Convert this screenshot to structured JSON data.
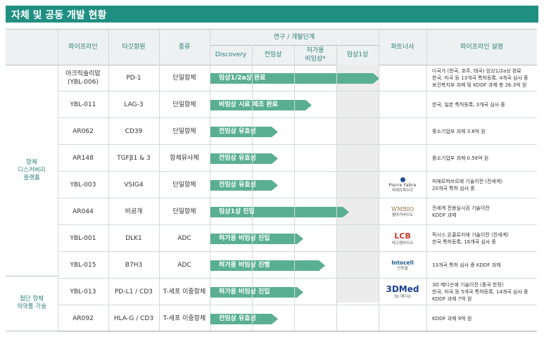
{
  "title": "자체 및 공동 개발 현황",
  "headers": {
    "pipeline": "파이프라인",
    "target": "타깃항원",
    "type": "종류",
    "stage_group": "연구 / 개발단계",
    "stages": [
      "Discovery",
      "전임상",
      "허가용\n비임상*",
      "임상1상"
    ],
    "partner": "파트너사",
    "description": "파이프라인 설명"
  },
  "platforms": [
    {
      "label": "항체\n디스커버리\n플랫폼"
    },
    {
      "label": "첨단 항체\n의약품 기술"
    }
  ],
  "rows": [
    {
      "pipeline": "아크릭솔리맙\n(YBL-006)",
      "target": "PD-1",
      "type": "단일항체",
      "stage_label": "임상1/2a상 완료",
      "progress": 1.0,
      "partner": "",
      "partner_sub": "",
      "description": [
        "다국가 (한국, 호주, 태국) 임상1/2a상 완료",
        "한국, 미국 등 13개국 특허등록, 4개국 심사 중",
        "보건복지부 과제 및 KDDF 과제 총 26.3억 원"
      ]
    },
    {
      "pipeline": "YBL-011",
      "target": "LAG-3",
      "type": "단일항체",
      "stage_label": "비임상 시료 제조 완료",
      "progress": 0.6,
      "partner": "",
      "partner_sub": "",
      "description": [
        "한국, 일본 특허등록, 3개국 심사 중"
      ]
    },
    {
      "pipeline": "AR062",
      "target": "CD39",
      "type": "단일항체",
      "stage_label": "전임상 유효성",
      "progress": 0.4,
      "partner": "",
      "partner_sub": "",
      "description": [
        "중소기업부 과제 3.6억 원"
      ]
    },
    {
      "pipeline": "AR148",
      "target": "TGFβ1 & 3",
      "type": "항체유사체",
      "stage_label": "전임상 유효성",
      "progress": 0.4,
      "partner": "",
      "partner_sub": "",
      "description": [
        "중소기업부 과제 0.58억 원"
      ]
    },
    {
      "pipeline": "YBL-003",
      "target": "VSIG4",
      "type": "단일항체",
      "stage_label": "전임상 유효성",
      "progress": 0.4,
      "partner": "Pierre Fabre",
      "partner_sub": "피에르파브르",
      "description": [
        "피에르파브르에 기술이전 (전세계)",
        "20개국 특허 심사 중"
      ]
    },
    {
      "pipeline": "AR044",
      "target": "비공개",
      "type": "단일항체",
      "stage_label": "임상1상 진입",
      "progress": 0.82,
      "partner": "WMBIO",
      "partner_sub": "웰마커바이오",
      "description": [
        "전세계 전용실시권 기술이전",
        "KDDF 과제"
      ]
    },
    {
      "pipeline": "YBL-001",
      "target": "DLK1",
      "type": "ADC",
      "stage_label": "허가용 비임상 진입",
      "progress": 0.55,
      "partner": "LCB",
      "partner_sub": "레고켐바이오",
      "description": [
        "픽시스 온콜로지에 기술이전 (전세계)",
        "한국 특허등록, 16개국 심사 중"
      ]
    },
    {
      "pipeline": "YBL-015",
      "target": "B7H3",
      "type": "ADC",
      "stage_label": "허가용 비임상 진행",
      "progress": 0.68,
      "partner": "Intocell",
      "partner_sub": "인투셀",
      "description": [
        "13개국 특허 심사 중 KDDF 과제"
      ]
    },
    {
      "pipeline": "YBL-013",
      "target": "PD-L1 / CD3",
      "type": "T-세포 이중항체",
      "stage_label": "허가용 비임상 진입",
      "progress": 0.55,
      "partner": "3DMed",
      "partner_sub": "3D 메디슨",
      "description": [
        "3D 메디슨에 기술이전 (중국 한정)",
        "한국, 미국 등 5개국 특허등록, 14개국 심사 중",
        "KDDF 과제 7억 원"
      ]
    },
    {
      "pipeline": "AR092",
      "target": "HLA-G / CD3",
      "type": "T-세포 이중항체",
      "stage_label": "전임상 유효성",
      "progress": 0.4,
      "partner": "",
      "partner_sub": "",
      "description": [
        "KDDF 과제 9억 원"
      ]
    }
  ],
  "colors": {
    "accent": "#1f8f82",
    "arrow": "#5aaf93",
    "header_bg": "#eef1f2"
  }
}
